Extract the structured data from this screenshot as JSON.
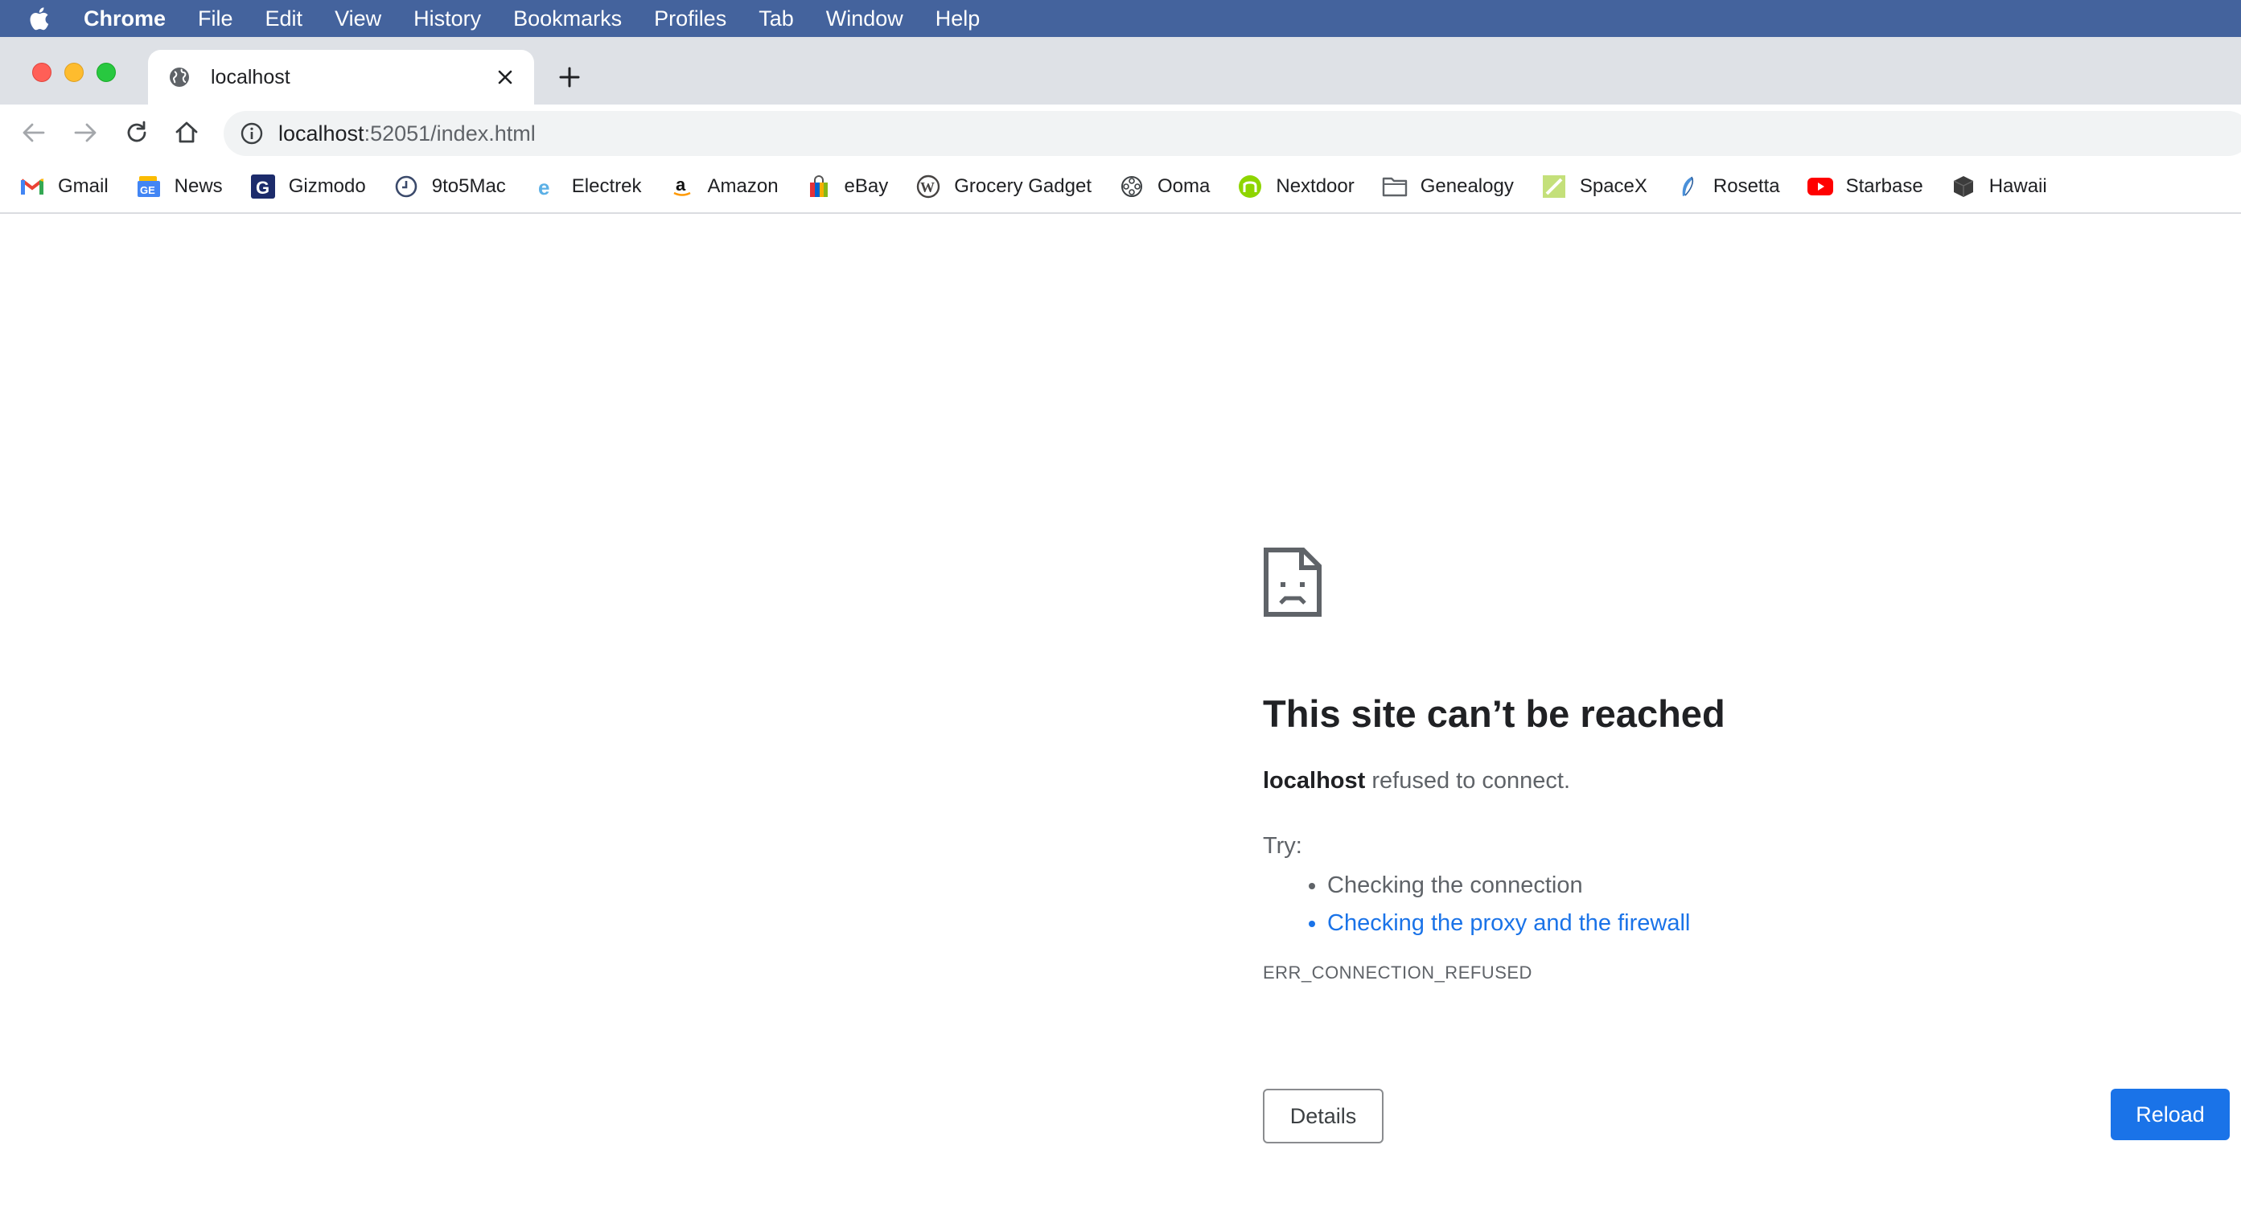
{
  "menubar": {
    "app_name": "Chrome",
    "items": [
      "File",
      "Edit",
      "View",
      "History",
      "Bookmarks",
      "Profiles",
      "Tab",
      "Window",
      "Help"
    ]
  },
  "tab": {
    "title": "localhost"
  },
  "omnibox": {
    "host": "localhost",
    "rest": ":52051/index.html"
  },
  "bookmarks": [
    {
      "label": "Gmail",
      "icon": "gmail-icon"
    },
    {
      "label": "News",
      "icon": "google-news-icon"
    },
    {
      "label": "Gizmodo",
      "icon": "gizmodo-icon"
    },
    {
      "label": "9to5Mac",
      "icon": "clock-icon"
    },
    {
      "label": "Electrek",
      "icon": "electrek-icon"
    },
    {
      "label": "Amazon",
      "icon": "amazon-icon"
    },
    {
      "label": "eBay",
      "icon": "shopping-bag-icon"
    },
    {
      "label": "Grocery Gadget",
      "icon": "wordpress-icon"
    },
    {
      "label": "Ooma",
      "icon": "ooma-icon"
    },
    {
      "label": "Nextdoor",
      "icon": "nextdoor-icon"
    },
    {
      "label": "Genealogy",
      "icon": "folder-icon"
    },
    {
      "label": "SpaceX",
      "icon": "spacex-icon"
    },
    {
      "label": "Rosetta",
      "icon": "feather-icon"
    },
    {
      "label": "Starbase",
      "icon": "youtube-icon"
    },
    {
      "label": "Hawaii",
      "icon": "cube-icon"
    }
  ],
  "error": {
    "heading": "This site can’t be reached",
    "host": "localhost",
    "summary_rest": " refused to connect.",
    "try_label": "Try:",
    "suggestions": [
      "Checking the connection",
      "Checking the proxy and the firewall"
    ],
    "code": "ERR_CONNECTION_REFUSED",
    "details_label": "Details",
    "reload_label": "Reload"
  },
  "colors": {
    "menubar": "#44639d",
    "accent": "#1a73e8"
  }
}
